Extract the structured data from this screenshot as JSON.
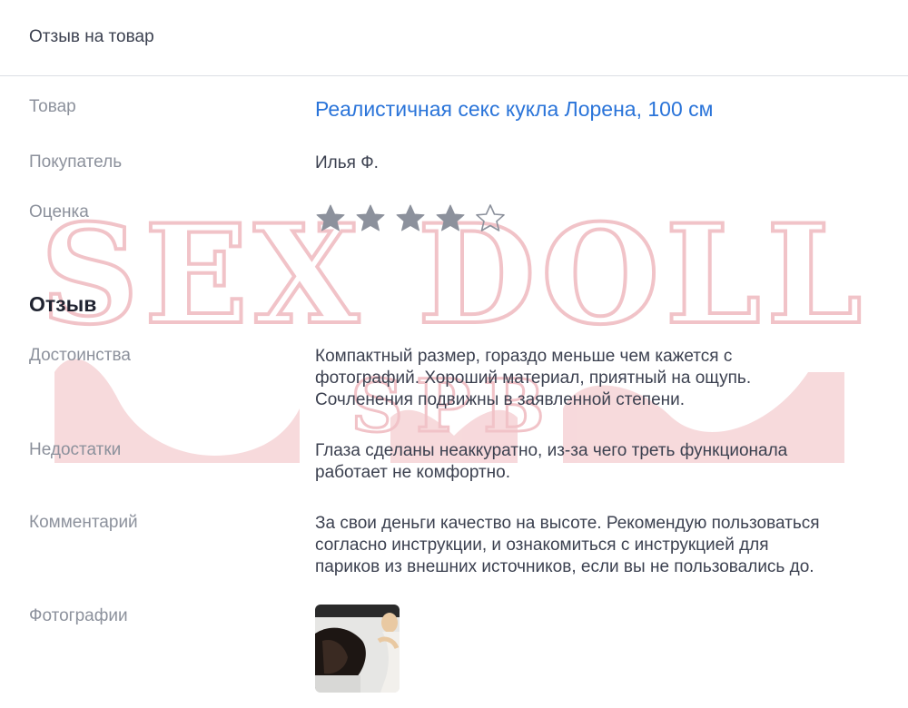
{
  "header": {
    "title": "Отзыв на товар"
  },
  "fields": {
    "product_label": "Товар",
    "product_value": "Реалистичная секс кукла Лорена, 100 см",
    "buyer_label": "Покупатель",
    "buyer_value": "Илья Ф.",
    "rating_label": "Оценка",
    "rating": {
      "value": 4,
      "max": 5
    }
  },
  "review": {
    "title": "Отзыв",
    "pros_label": "Достоинства",
    "pros_lines": [
      "Компактный размер, гораздо меньше чем кажется с",
      "фотографий. Хороший материал, приятный на ощупь.",
      "Сочленения подвижны в заявленной степени."
    ],
    "cons_label": "Недостатки",
    "cons_lines": [
      "Глаза сделаны неаккуратно, из-за чего треть функционала",
      "работает не комфортно."
    ],
    "comment_label": "Комментарий",
    "comment_lines": [
      "За свои деньги качество на высоте. Рекомендую пользоваться",
      "согласно инструкции, и ознакомиться с инструкцией для",
      "париков из внешних источников, если вы не пользовались до."
    ],
    "photos_label": "Фотографии"
  },
  "watermark": {
    "line1": "SEX DOLL",
    "line2": "SPB"
  },
  "colors": {
    "link": "#2a74d9",
    "star": "#8c919c",
    "label": "#8c919c",
    "text": "#3c4150",
    "watermark": "#f3c9cd"
  },
  "icons": {
    "star_filled": "star-filled-icon",
    "star_empty": "star-outline-icon"
  }
}
